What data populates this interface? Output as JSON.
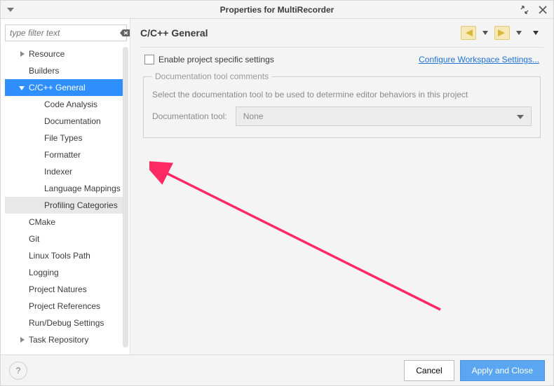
{
  "window": {
    "title": "Properties for MultiRecorder"
  },
  "sidebar": {
    "filter_placeholder": "type filter text",
    "items": [
      {
        "label": "Resource",
        "level": 1,
        "expandable": true,
        "expanded": false
      },
      {
        "label": "Builders",
        "level": 1,
        "expandable": false
      },
      {
        "label": "C/C++ General",
        "level": 1,
        "expandable": true,
        "expanded": true,
        "selected": true
      },
      {
        "label": "Code Analysis",
        "level": 2,
        "expandable": true,
        "expanded": false
      },
      {
        "label": "Documentation",
        "level": 2,
        "expandable": false
      },
      {
        "label": "File Types",
        "level": 2,
        "expandable": false
      },
      {
        "label": "Formatter",
        "level": 2,
        "expandable": false
      },
      {
        "label": "Indexer",
        "level": 2,
        "expandable": false
      },
      {
        "label": "Language Mappings",
        "level": 2,
        "expandable": false
      },
      {
        "label": "Profiling Categories",
        "level": 2,
        "expandable": false,
        "hovered": true
      },
      {
        "label": "CMake",
        "level": 1,
        "expandable": false
      },
      {
        "label": "Git",
        "level": 1,
        "expandable": false
      },
      {
        "label": "Linux Tools Path",
        "level": 1,
        "expandable": false
      },
      {
        "label": "Logging",
        "level": 1,
        "expandable": false
      },
      {
        "label": "Project Natures",
        "level": 1,
        "expandable": false
      },
      {
        "label": "Project References",
        "level": 1,
        "expandable": false
      },
      {
        "label": "Run/Debug Settings",
        "level": 1,
        "expandable": false
      },
      {
        "label": "Task Repository",
        "level": 1,
        "expandable": true,
        "expanded": false
      }
    ]
  },
  "page": {
    "heading": "C/C++ General",
    "enable_checkbox_label": "Enable project specific settings",
    "enable_checked": false,
    "configure_link": "Configure Workspace Settings...",
    "group_title": "Documentation tool comments",
    "group_desc": "Select the documentation tool to be used to determine editor behaviors in this project",
    "doc_tool_label": "Documentation tool:",
    "doc_tool_value": "None"
  },
  "footer": {
    "cancel": "Cancel",
    "apply_close": "Apply and Close"
  },
  "colors": {
    "selection": "#2f8fff",
    "link": "#1f71d4",
    "primary_btn": "#5aa6f1"
  }
}
